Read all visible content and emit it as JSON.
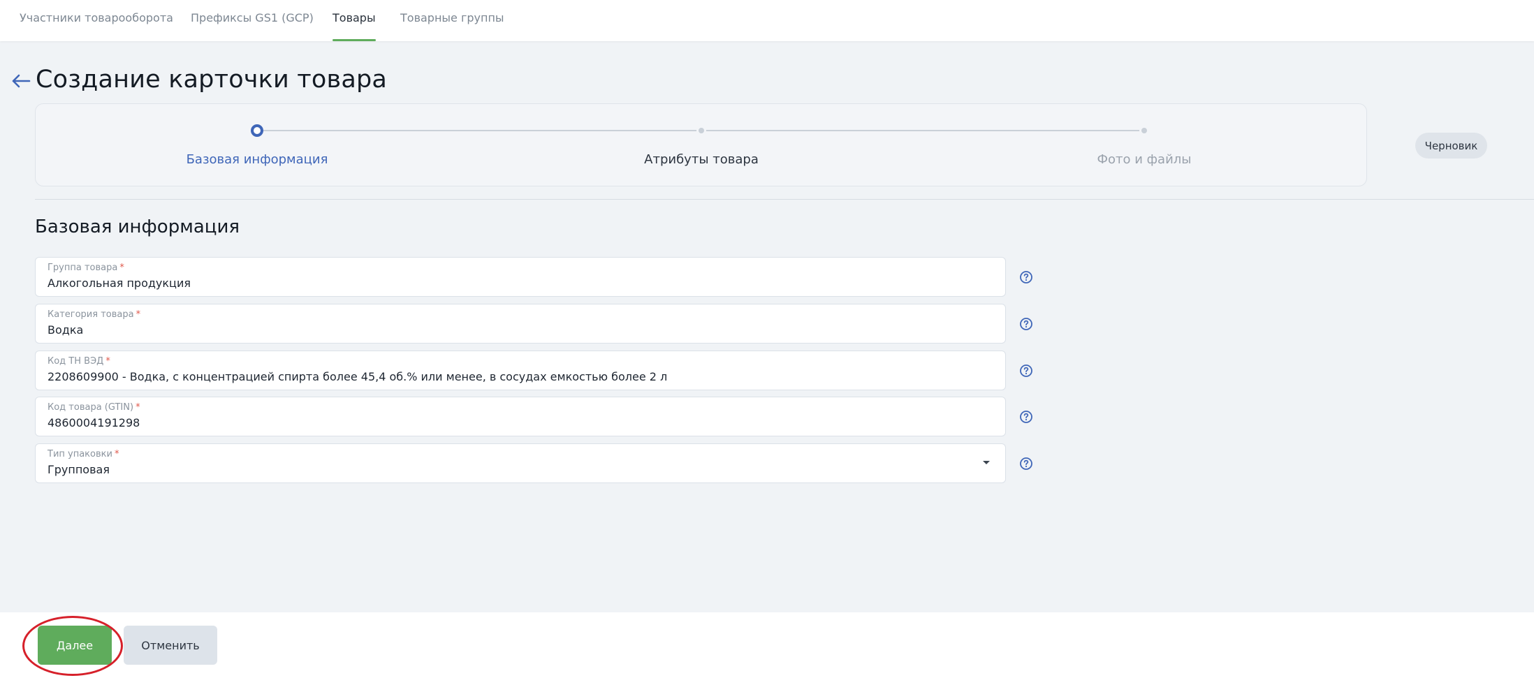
{
  "nav": {
    "tabs": [
      {
        "label": "Участники товарооборота"
      },
      {
        "label": "Префиксы GS1 (GCP)"
      },
      {
        "label": "Товары"
      },
      {
        "label": "Товарные группы"
      }
    ],
    "active_tab": "Товары"
  },
  "page": {
    "title": "Создание карточки товара",
    "status_badge": "Черновик"
  },
  "stepper": {
    "steps": [
      {
        "label": "Базовая информация",
        "state": "current"
      },
      {
        "label": "Атрибуты товара",
        "state": "pending"
      },
      {
        "label": "Фото и файлы",
        "state": "disabled"
      }
    ]
  },
  "section": {
    "title": "Базовая информация"
  },
  "fields": [
    {
      "label": "Группа товара",
      "required_mark": "*",
      "value": "Алкогольная продукция"
    },
    {
      "label": "Категория товара",
      "required_mark": "*",
      "value": "Водка"
    },
    {
      "label": "Код ТН ВЭД",
      "required_mark": "*",
      "value": "2208609900 - Водка, с концентрацией спирта более 45,4 об.% или менее, в сосудах емкостью более 2 л"
    },
    {
      "label": "Код товара (GTIN)",
      "required_mark": "*",
      "value": "4860004191298"
    },
    {
      "label": "Тип упаковки",
      "required_mark": "*",
      "value": "Групповая"
    }
  ],
  "actions": {
    "next_label": "Далее",
    "cancel_label": "Отменить"
  },
  "colors": {
    "accent_green": "#5fac5c",
    "step_active_blue": "#3f66b8",
    "highlight_red": "#d6202a",
    "required_red": "#e0584b"
  },
  "icons": {
    "back": "arrow-left-icon",
    "help": "question-circle-icon",
    "dropdown": "caret-down-icon"
  }
}
